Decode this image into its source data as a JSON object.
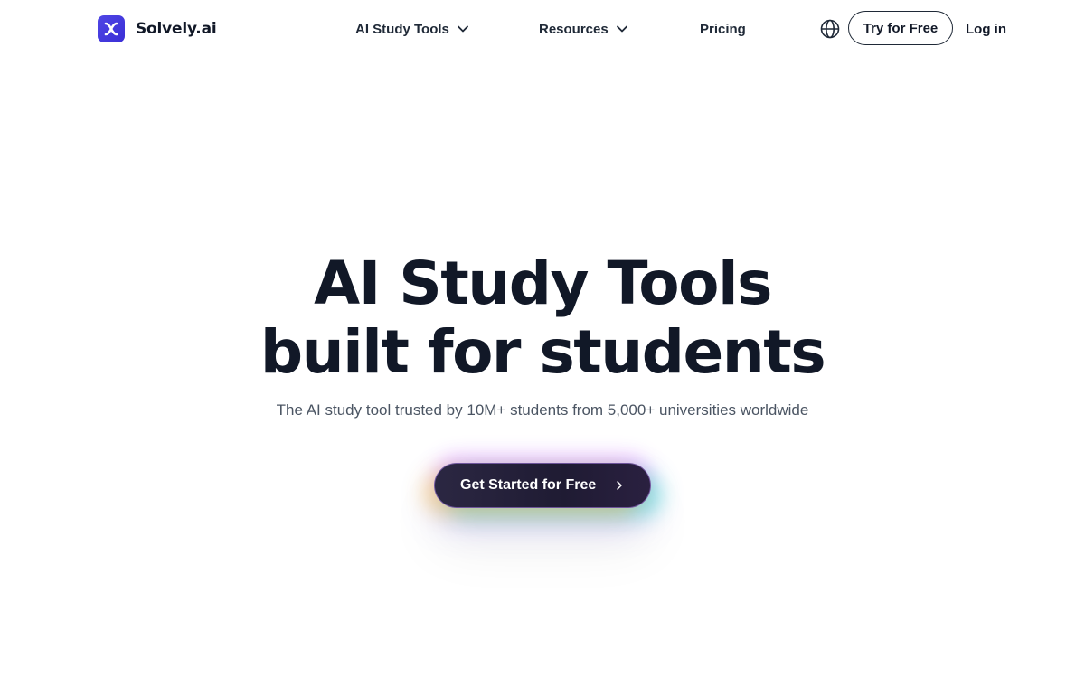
{
  "brand": {
    "name": "Solvely.ai",
    "accent": "#4f46e5"
  },
  "nav": {
    "items": [
      {
        "label": "AI Study Tools",
        "icon": "chevron-down-icon"
      },
      {
        "label": "Resources",
        "icon": "chevron-down-icon"
      },
      {
        "label": "Pricing"
      }
    ],
    "language_icon": "globe-icon",
    "try_label": "Try for Free",
    "login_label": "Log in"
  },
  "hero": {
    "title_line1": "AI Study Tools",
    "title_line2": "built for students",
    "subtitle": "The AI study tool trusted by 10M+ students from 5,000+ universities worldwide",
    "cta_label": "Get Started for Free",
    "cta_icon": "chevron-right-icon"
  }
}
